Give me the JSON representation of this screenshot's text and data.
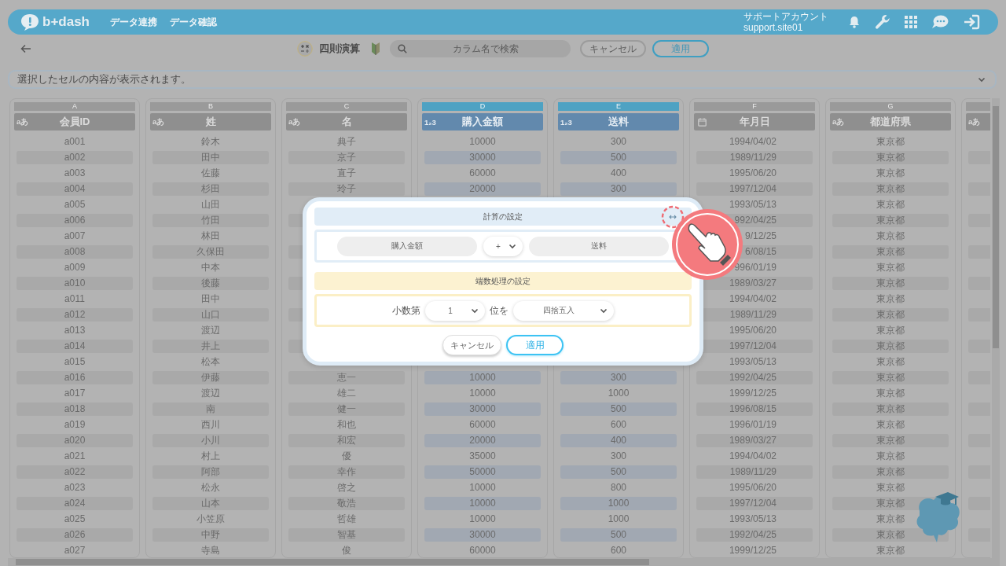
{
  "topbar": {
    "logo": "b+dash",
    "nav": [
      "データ連携",
      "データ確認"
    ],
    "account_label": "サポートアカウント",
    "account_id": "support.site01"
  },
  "toolbar": {
    "title": "四則演算",
    "search": {
      "placeholder": "カラム名で検索"
    },
    "buttons": [
      {
        "label": "キャンセル",
        "kind": "secondary"
      },
      {
        "label": "適用",
        "kind": "primary"
      }
    ]
  },
  "cell_preview": {
    "text": "選択したセルの内容が表示されます。"
  },
  "columns": [
    {
      "letter": "A",
      "name": "会員ID",
      "kind": "text",
      "type_mark": "aあ",
      "selected": false,
      "cells": [
        "a001",
        "a002",
        "a003",
        "a004",
        "a005",
        "a006",
        "a007",
        "a008",
        "a009",
        "a010",
        "a011",
        "a012",
        "a013",
        "a014",
        "a015",
        "a016",
        "a017",
        "a018",
        "a019",
        "a020",
        "a021",
        "a022",
        "a023",
        "a024",
        "a025",
        "a026",
        "a027"
      ]
    },
    {
      "letter": "B",
      "name": "姓",
      "kind": "text",
      "type_mark": "aあ",
      "selected": false,
      "cells": [
        "鈴木",
        "田中",
        "佐藤",
        "杉田",
        "山田",
        "竹田",
        "林田",
        "久保田",
        "中本",
        "後藤",
        "田中",
        "山口",
        "渡辺",
        "井上",
        "松本",
        "伊藤",
        "渡辺",
        "南",
        "西川",
        "小川",
        "村上",
        "阿部",
        "松永",
        "山本",
        "小笠原",
        "中野",
        "寺島"
      ]
    },
    {
      "letter": "C",
      "name": "名",
      "kind": "text",
      "type_mark": "aあ",
      "selected": false,
      "cells": [
        "典子",
        "京子",
        "直子",
        "玲子",
        null,
        null,
        null,
        null,
        null,
        null,
        null,
        null,
        null,
        null,
        null,
        "恵一",
        "雄二",
        "健一",
        "和也",
        "和宏",
        "優",
        "幸作",
        "啓之",
        "敬浩",
        "哲雄",
        "智基",
        "俊"
      ]
    },
    {
      "letter": "D",
      "name": "購入金額",
      "kind": "number",
      "type_mark": "1₂3",
      "selected": true,
      "cells": [
        "10000",
        "30000",
        "60000",
        "20000",
        null,
        null,
        null,
        null,
        null,
        null,
        null,
        null,
        null,
        null,
        null,
        "10000",
        "10000",
        "30000",
        "60000",
        "20000",
        "35000",
        "50000",
        "10000",
        "10000",
        "10000",
        "30000",
        "60000"
      ]
    },
    {
      "letter": "E",
      "name": "送料",
      "kind": "number",
      "type_mark": "1₂3",
      "selected": true,
      "cells": [
        "300",
        "500",
        "400",
        "300",
        null,
        null,
        null,
        null,
        null,
        null,
        null,
        null,
        null,
        null,
        null,
        "300",
        "1000",
        "500",
        "600",
        "400",
        "300",
        "500",
        "800",
        "1000",
        "1000",
        "500",
        "600"
      ]
    },
    {
      "letter": "F",
      "name": "年月日",
      "kind": "date",
      "selected": false,
      "cells": [
        "1994/04/02",
        "1989/11/29",
        "1995/06/20",
        "1997/12/04",
        "1993/05/13",
        "992/04/25",
        "9/12/25",
        "6/08/15",
        "996/01/19",
        "1989/03/27",
        "1994/04/02",
        "1989/11/29",
        "1995/06/20",
        "1997/12/04",
        "1993/05/13",
        "1992/04/25",
        "1999/12/25",
        "1996/08/15",
        "1996/01/19",
        "1989/03/27",
        "1994/04/02",
        "1989/11/29",
        "1995/06/20",
        "1997/12/04",
        "1993/05/13",
        "1992/04/25",
        "1999/12/25"
      ]
    },
    {
      "letter": "G",
      "name": "都道府県",
      "kind": "text",
      "type_mark": "aあ",
      "selected": false,
      "cells": [
        "東京都",
        "東京都",
        "東京都",
        "東京都",
        "東京都",
        "東京都",
        "東京都",
        "東京都",
        "東京都",
        "東京都",
        "東京都",
        "東京都",
        "東京都",
        "東京都",
        "東京都",
        "東京都",
        "東京都",
        "東京都",
        "東京都",
        "東京都",
        "東京都",
        "東京都",
        "東京都",
        "東京都",
        "東京都",
        "東京都",
        "東京都"
      ]
    },
    {
      "kind": "text",
      "type_mark": "aあ",
      "selected": false
    }
  ],
  "calc_modal": {
    "calc_section": {
      "title": "計算の設定",
      "left_operand": "購入金額",
      "operator": "+",
      "right_operand": "送料"
    },
    "rounding_section": {
      "title": "端数処理の設定",
      "prefix": "小数第",
      "digit": "1",
      "middle": "位を",
      "method": "四捨五入"
    },
    "buttons": [
      {
        "label": "キャンセル",
        "kind": "secondary"
      },
      {
        "label": "適用",
        "kind": "primary"
      }
    ]
  }
}
